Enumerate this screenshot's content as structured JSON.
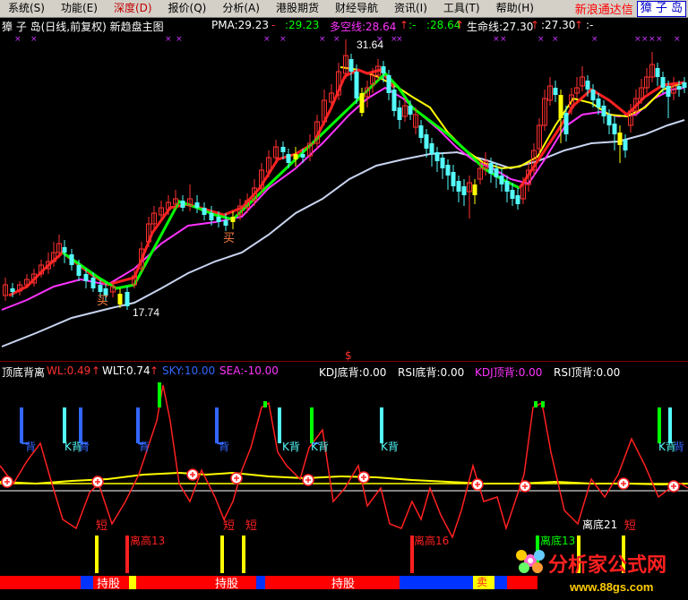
{
  "menu": {
    "items": [
      "系统(S)",
      "功能(E)",
      "深度(D)",
      "报价(Q)",
      "分析(A)",
      "港股期货",
      "财经导航",
      "资讯(I)",
      "工具(T)",
      "帮助(H)"
    ],
    "active_index": 2,
    "brand": "新浪通达信",
    "brand_box": "獐 子 岛"
  },
  "main_legend": {
    "title": "獐 子 岛(日线,前复权) 新趋盘主图",
    "pma": "PMA:29.23",
    "pma_dash": "-",
    "pma2": ":29.23",
    "dkx": "多空线:28.64",
    "dkx_arrow": "↑",
    "dkx2": ":-",
    "dkx3": ":28.64",
    "dkx3_arrow": "↑",
    "life": "生命线:27.30",
    "life_arrow": "↑",
    "life2": ":27.30",
    "life2_arrow": "↑",
    "life_dash": ":-"
  },
  "price_labels": {
    "high": "31.64",
    "low": "17.74",
    "buy": "买",
    "dollar": "$"
  },
  "sub_legend": {
    "title": "顶底背离",
    "wl": "WL:0.49",
    "wl_arrow": "↑",
    "wlt": "WLT:0.74",
    "wlt_arrow": "↑",
    "sky": "SKY:10.00",
    "sea": "SEA:-10.00",
    "kdj_bottom": "KDJ底背:0.00",
    "rsi_bottom": "RSI底背:0.00",
    "kdj_top": "KDJ顶背:0.00",
    "rsi_top": "RSI顶背:0.00"
  },
  "signals": {
    "back": "背",
    "k_back": "K背",
    "short": "短",
    "hold": "持股",
    "sell": "卖",
    "top_dev_1": "离高13",
    "top_dev_2": "离高16",
    "bot_dev_1": "离底13",
    "bot_dev_2": "离底21"
  },
  "watermark": {
    "title": "分析家公式网",
    "url": "www.88gs.com"
  },
  "colors": {
    "up": "#ff3030",
    "down": "#54fcfc",
    "ma_white": "#c8d4f0",
    "ma_yellow": "#ffff00",
    "ma_magenta": "#ff33ff",
    "green": "#00ff00"
  }
}
